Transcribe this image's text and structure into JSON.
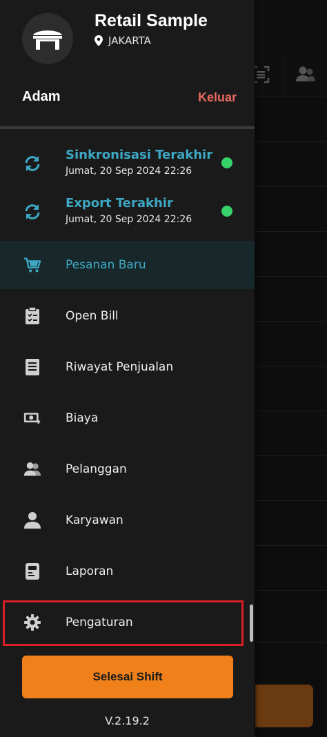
{
  "store": {
    "name": "Retail Sample",
    "location": "JAKARTA"
  },
  "user": {
    "name": "Adam",
    "logout_label": "Keluar"
  },
  "sync": [
    {
      "title": "Sinkronisasi Terakhir",
      "time": "Jumat, 20 Sep 2024 22:26",
      "status_color": "#37d36a"
    },
    {
      "title": "Export Terakhir",
      "time": "Jumat, 20 Sep 2024 22:26",
      "status_color": "#37d36a"
    }
  ],
  "menu": [
    {
      "label": "Pesanan Baru",
      "icon": "cart-icon",
      "active": true
    },
    {
      "label": "Open Bill",
      "icon": "clipboard-icon",
      "active": false
    },
    {
      "label": "Riwayat Penjualan",
      "icon": "document-icon",
      "active": false
    },
    {
      "label": "Biaya",
      "icon": "money-icon",
      "active": false
    },
    {
      "label": "Pelanggan",
      "icon": "customers-icon",
      "active": false
    },
    {
      "label": "Karyawan",
      "icon": "employee-icon",
      "active": false
    },
    {
      "label": "Laporan",
      "icon": "report-icon",
      "active": false
    },
    {
      "label": "Pengaturan",
      "icon": "gear-icon",
      "active": false
    }
  ],
  "shift_button": "Selesai Shift",
  "version": "V.2.19.2",
  "colors": {
    "accent": "#3ea8c4",
    "logout": "#e8695f",
    "shift_button": "#f08019",
    "highlight": "#d81f26"
  }
}
